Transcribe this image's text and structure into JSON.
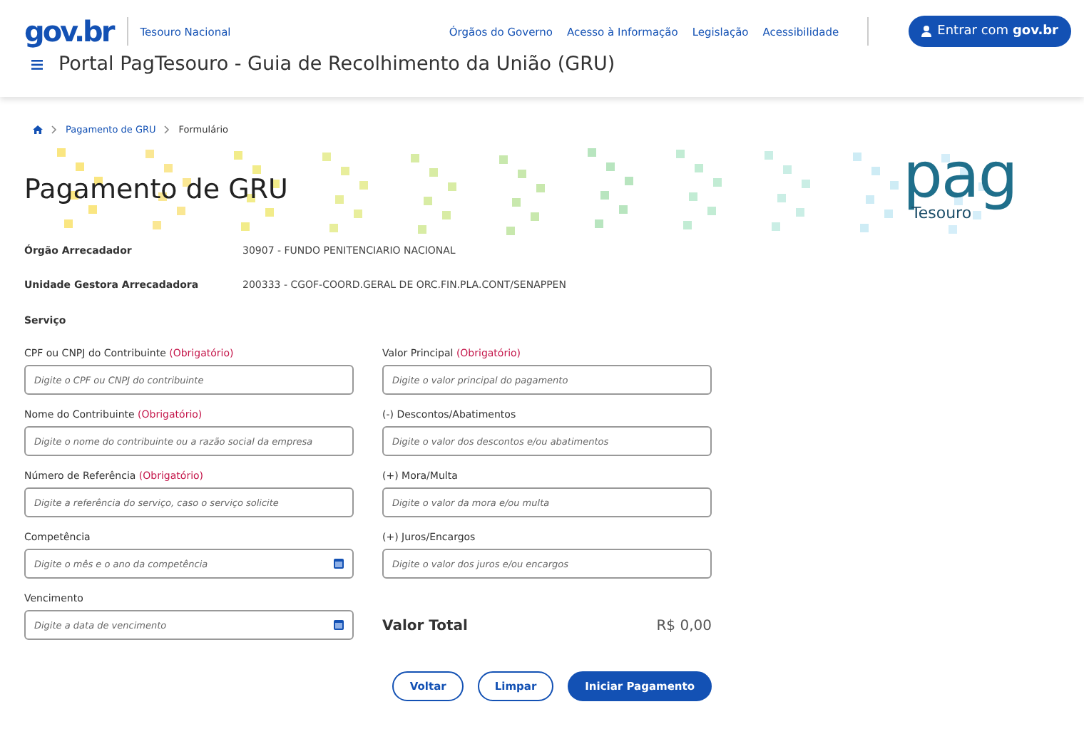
{
  "header": {
    "logo": "gov.br",
    "org": "Tesouro Nacional",
    "nav": [
      "Órgãos do Governo",
      "Acesso à Informação",
      "Legislação",
      "Acessibilidade"
    ],
    "login": {
      "label": "Entrar com ",
      "brand": "gov.br"
    },
    "title": "Portal PagTesouro - Guia de Recolhimento da União (GRU)"
  },
  "breadcrumb": [
    "Pagamento de GRU",
    "Formulário"
  ],
  "banner": {
    "title": "Pagamento de GRU",
    "logo_main": "pag",
    "logo_sub": "Tesouro"
  },
  "info": [
    {
      "label": "Órgão Arrecadador",
      "value": "30907 - FUNDO PENITENCIARIO NACIONAL"
    },
    {
      "label": "Unidade Gestora Arrecadadora",
      "value": "200333 - CGOF-COORD.GERAL DE ORC.FIN.PLA.CONT/SENAPPEN"
    }
  ],
  "section": "Serviço",
  "left_fields": [
    {
      "label": "CPF ou CNPJ do Contribuinte",
      "required": "(Obrigatório)",
      "placeholder": "Digite o CPF ou CNPJ do contribuinte",
      "kind": "text"
    },
    {
      "label": "Nome do Contribuinte",
      "required": "(Obrigatório)",
      "placeholder": "Digite o nome do contribuinte ou a razão social da empresa",
      "kind": "text"
    },
    {
      "label": "Número de Referência",
      "required": "(Obrigatório)",
      "placeholder": "Digite a referência do serviço, caso o serviço solicite",
      "kind": "text"
    },
    {
      "label": "Competência",
      "placeholder": "Digite o mês e o ano da competência",
      "kind": "date"
    },
    {
      "label": "Vencimento",
      "placeholder": "Digite a data de vencimento",
      "kind": "date"
    }
  ],
  "right_fields": [
    {
      "label": "Valor Principal",
      "required": "(Obrigatório)",
      "placeholder": "Digite o valor principal do pagamento"
    },
    {
      "label": "(-) Descontos/Abatimentos",
      "placeholder": "Digite o valor dos descontos e/ou abatimentos"
    },
    {
      "label": "(+) Mora/Multa",
      "placeholder": "Digite o valor da mora e/ou multa"
    },
    {
      "label": "(+) Juros/Encargos",
      "placeholder": "Digite o valor dos juros e/ou encargos"
    }
  ],
  "total": {
    "label": "Valor Total",
    "value": "R$ 0,00"
  },
  "buttons": [
    {
      "label": "Voltar",
      "kind": "secondary"
    },
    {
      "label": "Limpar",
      "kind": "secondary"
    },
    {
      "label": "Iniciar Pagamento",
      "kind": "primary"
    }
  ]
}
